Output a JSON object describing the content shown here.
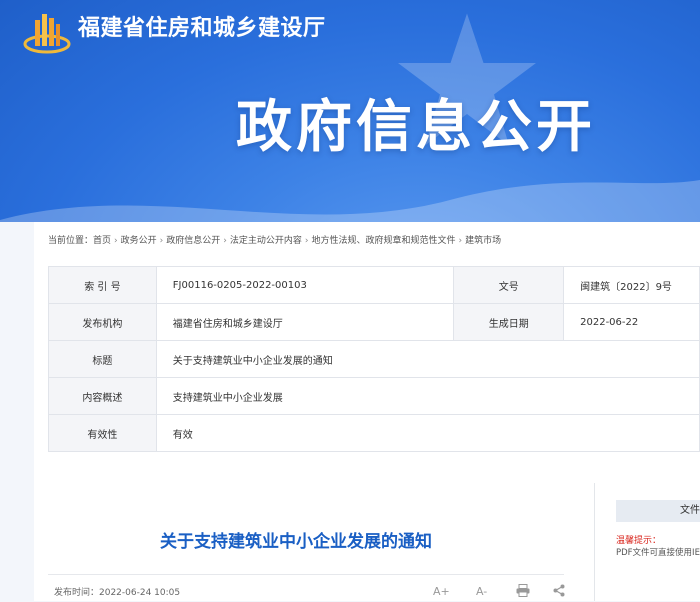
{
  "header": {
    "site_title": "福建省住房和城乡建设厅",
    "banner_title": "政府信息公开"
  },
  "breadcrumb": {
    "prefix": "当前位置：",
    "items": [
      "首页",
      "政务公开",
      "政府信息公开",
      "法定主动公开内容",
      "地方性法规、政府规章和规范性文件",
      "建筑市场"
    ]
  },
  "meta": {
    "index_label": "索 引 号",
    "index_value": "FJ00116-0205-2022-00103",
    "doc_no_label": "文号",
    "doc_no_value": "闽建筑〔2022〕9号",
    "org_label": "发布机构",
    "org_value": "福建省住房和城乡建设厅",
    "date_label": "生成日期",
    "date_value": "2022-06-22",
    "title_label": "标题",
    "title_value": "关于支持建筑业中小企业发展的通知",
    "summary_label": "内容概述",
    "summary_value": "支持建筑业中小企业发展",
    "validity_label": "有效性",
    "validity_value": "有效"
  },
  "article": {
    "title": "关于支持建筑业中小企业发展的通知",
    "publish_time": "发布时间：2022-06-24 10:05",
    "font_increase": "A+",
    "font_decrease": "A-"
  },
  "sidebar": {
    "file_label": "文件",
    "tip_label": "温馨提示：",
    "tip_text": "PDF文件可直接使用IE"
  },
  "colors": {
    "banner_blue": "#2a6fdc",
    "title_blue": "#1a5fc4",
    "tip_red": "#d9251c"
  }
}
